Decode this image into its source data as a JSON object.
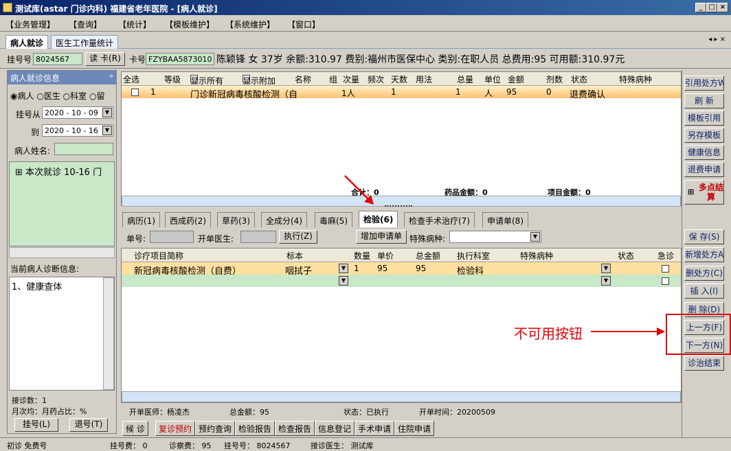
{
  "window": {
    "title": "测试库(astar 门诊内科) 福建省老年医院 - [病人就诊]"
  },
  "menu": [
    "【业务管理】",
    "【查询】",
    "【统计】",
    "【模板维护】",
    "【系统维护】",
    "【窗口】"
  ],
  "tabs": [
    "病人就诊",
    "医生工作量统计"
  ],
  "patient": {
    "reg_label": "挂号号",
    "reg_no": "8024567",
    "read_card": "读 卡(R)",
    "card_label": "卡号",
    "card_no": "FZYBAA5873010",
    "info": "陈颖锋 女 37岁 余额:310.97 费别:福州市医保中心 类别:在职人员 总费用:95 可用额:310.97元"
  },
  "left": {
    "header": "病人就诊信息",
    "radio": [
      "病人",
      "医生",
      "科室",
      "留"
    ],
    "from_label": "挂号从",
    "from_date": "2020 - 10 - 09",
    "to_label": "到",
    "to_date": "2020 - 10 - 16",
    "name_label": "病人姓名:",
    "tree_item": "本次就诊 10-16 门",
    "diag_header": "当前病人诊断信息:",
    "diag_item": "1、健康查体",
    "count": "接诊数：1",
    "ratio": "月次均：月药占比：%",
    "reg_btn": "挂号(L)",
    "unreg_btn": "退号(T)"
  },
  "upper_grid": {
    "headers": [
      "全选",
      "等级",
      "显示所有",
      "显示附加",
      "名称",
      "组",
      "次量",
      "频次",
      "天数",
      "用法",
      "总量",
      "单位",
      "金额",
      "剂数",
      "状态",
      "特殊病种"
    ],
    "row": {
      "level": "1",
      "name": "门诊新冠病毒核酸检测（自",
      "dose": "1人",
      "days": "1",
      "total": "1",
      "unit": "人",
      "amount": "95",
      "doses": "0",
      "status": "退费确认"
    },
    "sum": "合计：0",
    "drug_sum": "药品金额：0",
    "item_sum": "项目金额：0"
  },
  "subtabs": [
    "病历(1)",
    "西成药(2)",
    "草药(3)",
    "全成分(4)",
    "毒麻(5)",
    "检验(6)",
    "检查手术治疗(7)",
    "申请单(8)"
  ],
  "exam": {
    "order_label": "单号:",
    "doctor_label": "开单医生:",
    "exec_btn": "执行(Z)",
    "add_btn": "增加申请单",
    "disease_label": "特殊病种:",
    "headers": [
      "诊疗项目简称",
      "标本",
      "数量",
      "单价",
      "总金额",
      "执行科室",
      "特殊病种",
      "状态",
      "急诊"
    ],
    "row": {
      "name": "新冠病毒核酸检测（自费）",
      "sample": "咽拭子",
      "qty": "1",
      "price": "95",
      "total": "95",
      "dept": "检验科"
    },
    "footer": {
      "doctor": "开单医师：杨凌杰",
      "total": "总金额：95",
      "status": "状态：已执行",
      "time": "开单时间：20200509"
    }
  },
  "bottom_tabs": [
    "候 诊",
    "复诊预约",
    "预约查询",
    "检验报告",
    "检查报告",
    "信息登记",
    "手术申请",
    "住院申请"
  ],
  "side_buttons": [
    "引用处方W",
    "刷 新",
    "模板引用",
    "另存模板",
    "健康信息",
    "退费申请",
    "多点结算",
    "保 存(S)",
    "新增处方A",
    "删处方(C)",
    "插 入(I)",
    "删 除(D)",
    "上一方(F)",
    "下一方(N)",
    "诊治结束"
  ],
  "annotation": "不可用按钮",
  "status": {
    "type": "初诊 免费号",
    "reg_fee": "挂号费： 0",
    "diag_fee": "诊察费： 95",
    "reg_no": "挂号号： 8024567",
    "doctor": "接诊医生： 测试库"
  },
  "colors": {
    "highlight_row": "#fde0a0",
    "green_row": "#c8e8c8",
    "annotation": "#e00000"
  }
}
